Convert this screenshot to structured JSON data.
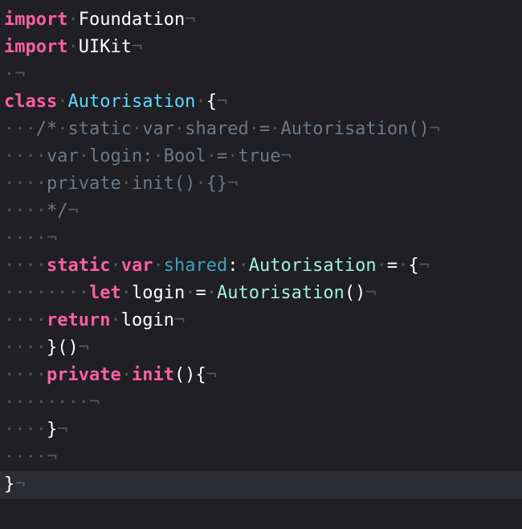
{
  "editor": {
    "language": "swift",
    "current_line": 17,
    "colors": {
      "background": "#1f1f24",
      "current_line_highlight": "#2c2c33",
      "keyword": "#fc5fa3",
      "plain": "#ffffff",
      "type_declaration": "#5dd8ff",
      "type_name": "#9ef1dd",
      "property": "#41a1c0",
      "comment": "#6c7986",
      "invisibles": "#55565f"
    },
    "lines": [
      [
        {
          "t": "kw",
          "v": "import"
        },
        {
          "t": "ws",
          "v": "·"
        },
        {
          "t": "pl",
          "v": "Foundation"
        },
        {
          "t": "ws",
          "v": "¬"
        }
      ],
      [
        {
          "t": "kw",
          "v": "import"
        },
        {
          "t": "ws",
          "v": "·"
        },
        {
          "t": "pl",
          "v": "UIKit"
        },
        {
          "t": "ws",
          "v": "¬"
        }
      ],
      [
        {
          "t": "ws",
          "v": "·¬"
        }
      ],
      [
        {
          "t": "kw",
          "v": "class"
        },
        {
          "t": "ws",
          "v": "·"
        },
        {
          "t": "tn",
          "v": "Autorisation"
        },
        {
          "t": "ws",
          "v": "·"
        },
        {
          "t": "pl",
          "v": "{"
        },
        {
          "t": "ws",
          "v": "¬"
        }
      ],
      [
        {
          "t": "ws",
          "v": "···"
        },
        {
          "t": "cm",
          "v": "/*"
        },
        {
          "t": "ws",
          "v": "·"
        },
        {
          "t": "cm",
          "v": "static"
        },
        {
          "t": "ws",
          "v": "·"
        },
        {
          "t": "cm",
          "v": "var"
        },
        {
          "t": "ws",
          "v": "·"
        },
        {
          "t": "cm",
          "v": "shared"
        },
        {
          "t": "ws",
          "v": "·"
        },
        {
          "t": "cm",
          "v": "="
        },
        {
          "t": "ws",
          "v": "·"
        },
        {
          "t": "cm",
          "v": "Autorisation()"
        },
        {
          "t": "ws",
          "v": "¬"
        }
      ],
      [
        {
          "t": "ws",
          "v": "····"
        },
        {
          "t": "cm",
          "v": "var"
        },
        {
          "t": "ws",
          "v": "·"
        },
        {
          "t": "cm",
          "v": "login:"
        },
        {
          "t": "ws",
          "v": "·"
        },
        {
          "t": "cm",
          "v": "Bool"
        },
        {
          "t": "ws",
          "v": "·"
        },
        {
          "t": "cm",
          "v": "="
        },
        {
          "t": "ws",
          "v": "·"
        },
        {
          "t": "cm",
          "v": "true"
        },
        {
          "t": "ws",
          "v": "¬"
        }
      ],
      [
        {
          "t": "ws",
          "v": "····"
        },
        {
          "t": "cm",
          "v": "private"
        },
        {
          "t": "ws",
          "v": "·"
        },
        {
          "t": "cm",
          "v": "init()"
        },
        {
          "t": "ws",
          "v": "·"
        },
        {
          "t": "cm",
          "v": "{}"
        },
        {
          "t": "ws",
          "v": "¬"
        }
      ],
      [
        {
          "t": "ws",
          "v": "····"
        },
        {
          "t": "cm",
          "v": "*/"
        },
        {
          "t": "ws",
          "v": "¬"
        }
      ],
      [
        {
          "t": "ws",
          "v": "····¬"
        }
      ],
      [
        {
          "t": "ws",
          "v": "····"
        },
        {
          "t": "kw",
          "v": "static"
        },
        {
          "t": "ws",
          "v": "·"
        },
        {
          "t": "kw",
          "v": "var"
        },
        {
          "t": "ws",
          "v": "·"
        },
        {
          "t": "pr",
          "v": "shared"
        },
        {
          "t": "pl",
          "v": ":"
        },
        {
          "t": "ws",
          "v": "·"
        },
        {
          "t": "ty",
          "v": "Autorisation"
        },
        {
          "t": "ws",
          "v": "·"
        },
        {
          "t": "pl",
          "v": "="
        },
        {
          "t": "ws",
          "v": "·"
        },
        {
          "t": "pl",
          "v": "{"
        },
        {
          "t": "ws",
          "v": "¬"
        }
      ],
      [
        {
          "t": "ws",
          "v": "········"
        },
        {
          "t": "kw",
          "v": "let"
        },
        {
          "t": "ws",
          "v": "·"
        },
        {
          "t": "pl",
          "v": "login"
        },
        {
          "t": "ws",
          "v": "·"
        },
        {
          "t": "pl",
          "v": "="
        },
        {
          "t": "ws",
          "v": "·"
        },
        {
          "t": "ty",
          "v": "Autorisation"
        },
        {
          "t": "pl",
          "v": "()"
        },
        {
          "t": "ws",
          "v": "¬"
        }
      ],
      [
        {
          "t": "ws",
          "v": "····"
        },
        {
          "t": "kw",
          "v": "return"
        },
        {
          "t": "ws",
          "v": "·"
        },
        {
          "t": "pl",
          "v": "login"
        },
        {
          "t": "ws",
          "v": "¬"
        }
      ],
      [
        {
          "t": "ws",
          "v": "····"
        },
        {
          "t": "pl",
          "v": "}()"
        },
        {
          "t": "ws",
          "v": "¬"
        }
      ],
      [
        {
          "t": "ws",
          "v": "····"
        },
        {
          "t": "kw",
          "v": "private"
        },
        {
          "t": "ws",
          "v": "·"
        },
        {
          "t": "kw",
          "v": "init"
        },
        {
          "t": "pl",
          "v": "(){"
        },
        {
          "t": "ws",
          "v": "¬"
        }
      ],
      [
        {
          "t": "ws",
          "v": "········¬"
        }
      ],
      [
        {
          "t": "ws",
          "v": "····"
        },
        {
          "t": "pl",
          "v": "}"
        },
        {
          "t": "ws",
          "v": "¬"
        }
      ],
      [
        {
          "t": "ws",
          "v": "····¬"
        }
      ],
      [
        {
          "t": "pl",
          "v": "}"
        },
        {
          "t": "ws",
          "v": "¬"
        }
      ]
    ]
  }
}
